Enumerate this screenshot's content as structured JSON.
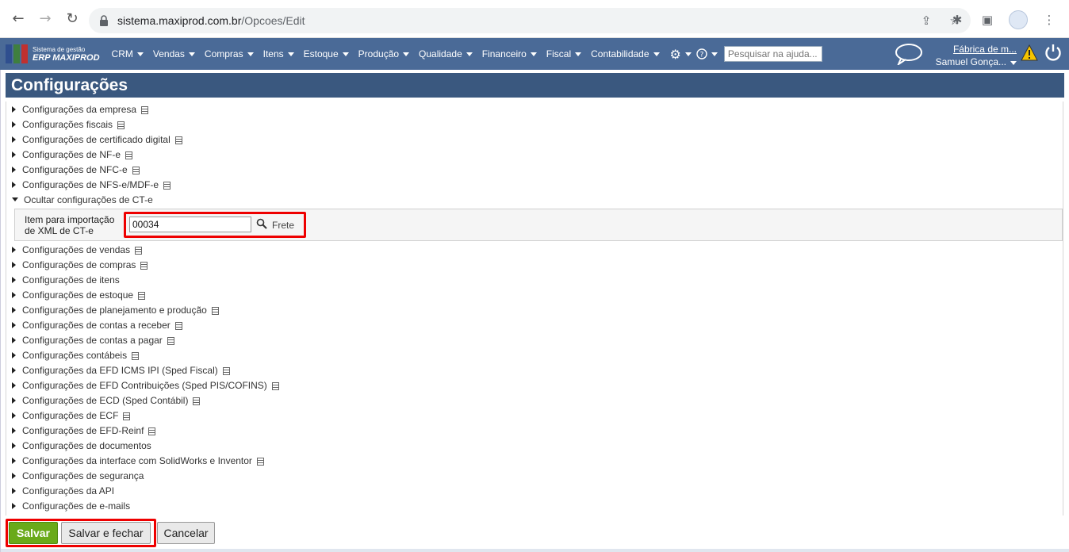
{
  "browser": {
    "url_host": "sistema.maxiprod.com.br",
    "url_path": "/Opcoes/Edit"
  },
  "app": {
    "brand_small": "Sistema de gestão",
    "brand_big": "ERP MAXIPROD",
    "menu": [
      "CRM",
      "Vendas",
      "Compras",
      "Itens",
      "Estoque",
      "Produção",
      "Qualidade",
      "Financeiro",
      "Fiscal",
      "Contabilidade"
    ],
    "help_search_placeholder": "Pesquisar na ajuda...",
    "company": "Fábrica de m...",
    "user": "Samuel Gonça...",
    "colors": {
      "appbar": "#4a6a97",
      "title": "#3a587f",
      "save": "#6aaa1a",
      "highlight": "#e00000"
    }
  },
  "page": {
    "title": "Configurações",
    "sections_before": [
      {
        "label": "Configurações da empresa",
        "doc": true
      },
      {
        "label": "Configurações fiscais",
        "doc": true
      },
      {
        "label": "Configurações de certificado digital",
        "doc": true
      },
      {
        "label": "Configurações de NF-e",
        "doc": true
      },
      {
        "label": "Configurações de NFC-e",
        "doc": true
      },
      {
        "label": "Configurações de NFS-e/MDF-e",
        "doc": true
      }
    ],
    "open_section": {
      "label": "Ocultar configurações de CT-e",
      "field_label_1": "Item para importação",
      "field_label_2": "de XML de CT-e",
      "field_value": "00034",
      "field_desc": "Frete"
    },
    "sections_after": [
      {
        "label": "Configurações de vendas",
        "doc": true
      },
      {
        "label": "Configurações de compras",
        "doc": true
      },
      {
        "label": "Configurações de itens",
        "doc": false
      },
      {
        "label": "Configurações de estoque",
        "doc": true
      },
      {
        "label": "Configurações de planejamento e produção",
        "doc": true
      },
      {
        "label": "Configurações de contas a receber",
        "doc": true
      },
      {
        "label": "Configurações de contas a pagar",
        "doc": true
      },
      {
        "label": "Configurações contábeis",
        "doc": true
      },
      {
        "label": "Configurações da EFD ICMS IPI (Sped Fiscal)",
        "doc": true
      },
      {
        "label": "Configurações de EFD Contribuições (Sped PIS/COFINS)",
        "doc": true
      },
      {
        "label": "Configurações de ECD (Sped Contábil)",
        "doc": true
      },
      {
        "label": "Configurações de ECF",
        "doc": true
      },
      {
        "label": "Configurações de EFD-Reinf",
        "doc": true
      },
      {
        "label": "Configurações de documentos",
        "doc": false
      },
      {
        "label": "Configurações da interface com SolidWorks e Inventor",
        "doc": true
      },
      {
        "label": "Configurações de segurança",
        "doc": false
      },
      {
        "label": "Configurações da API",
        "doc": false
      },
      {
        "label": "Configurações de e-mails",
        "doc": false
      }
    ]
  },
  "buttons": {
    "save": "Salvar",
    "save_close": "Salvar e fechar",
    "cancel": "Cancelar"
  }
}
